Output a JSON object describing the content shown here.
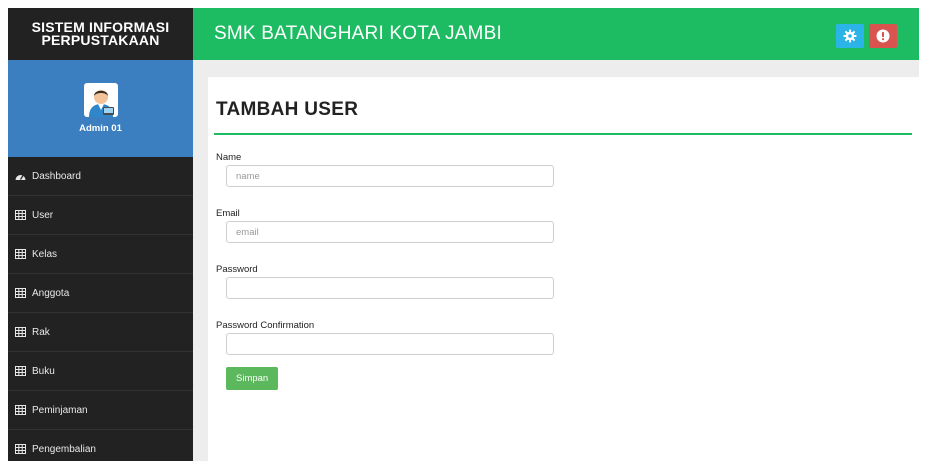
{
  "sidebar": {
    "brand_line1": "SISTEM INFORMASI",
    "brand_line2": "PERPUSTAKAAN",
    "user_name": "Admin 01",
    "items": [
      {
        "label": "Dashboard",
        "icon": "dashboard-icon"
      },
      {
        "label": "User",
        "icon": "table-icon"
      },
      {
        "label": "Kelas",
        "icon": "table-icon"
      },
      {
        "label": "Anggota",
        "icon": "table-icon"
      },
      {
        "label": "Rak",
        "icon": "table-icon"
      },
      {
        "label": "Buku",
        "icon": "table-icon"
      },
      {
        "label": "Peminjaman",
        "icon": "table-icon"
      },
      {
        "label": "Pengembalian",
        "icon": "table-icon"
      }
    ]
  },
  "header": {
    "title": "SMK BATANGHARI KOTA JAMBI",
    "buttons": [
      {
        "icon": "gear-icon",
        "color": "#2bb4e8"
      },
      {
        "icon": "alert-icon",
        "color": "#d9534f"
      }
    ]
  },
  "main": {
    "page_title": "TAMBAH USER",
    "form": {
      "name_label": "Name",
      "name_placeholder": "name",
      "name_value": "",
      "email_label": "Email",
      "email_placeholder": "email",
      "email_value": "",
      "password_label": "Password",
      "password_placeholder": "",
      "password_value": "",
      "password_confirmation_label": "Password Confirmation",
      "password_confirmation_placeholder": "",
      "password_confirmation_value": "",
      "submit_label": "Simpan"
    }
  },
  "colors": {
    "accent": "#1dbb62",
    "sidebar_bg": "#222222",
    "profile_bg": "#3c7fc1",
    "button_success": "#5cb85c",
    "button_info": "#2bb4e8",
    "button_danger": "#d9534f"
  }
}
